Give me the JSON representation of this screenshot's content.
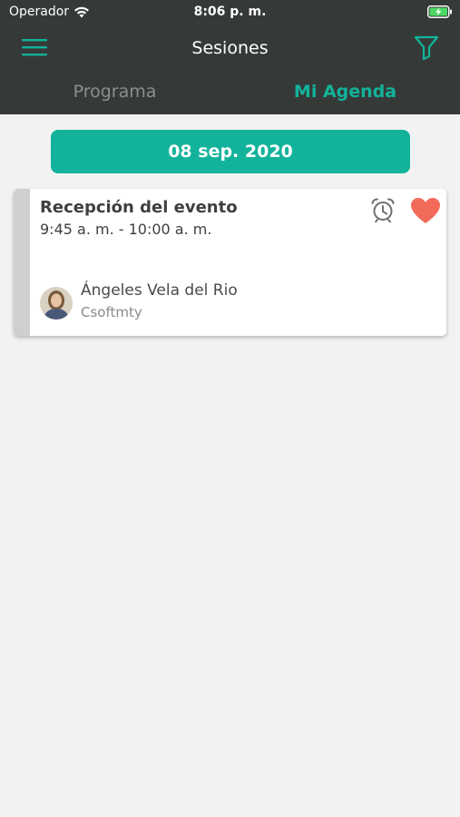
{
  "status_bar": {
    "carrier": "Operador",
    "time": "8:06 p. m."
  },
  "navbar": {
    "title": "Sesiones",
    "menu_icon": "hamburger-menu-icon",
    "filter_icon": "filter-icon"
  },
  "tabs": [
    {
      "label": "Programa",
      "active": false
    },
    {
      "label": "Mi Agenda",
      "active": true
    }
  ],
  "date_selector": {
    "label": "08 sep. 2020"
  },
  "sessions": [
    {
      "title": "Recepción del evento",
      "time": "9:45 a. m. - 10:00 a. m.",
      "speaker": {
        "name": "Ángeles Vela del Rio",
        "company": "Csoftmty"
      },
      "favorite": true
    }
  ],
  "colors": {
    "header_bg": "#353a39",
    "accent": "#12b39a",
    "favorite": "#f26a5a",
    "background": "#f2f2f2"
  }
}
